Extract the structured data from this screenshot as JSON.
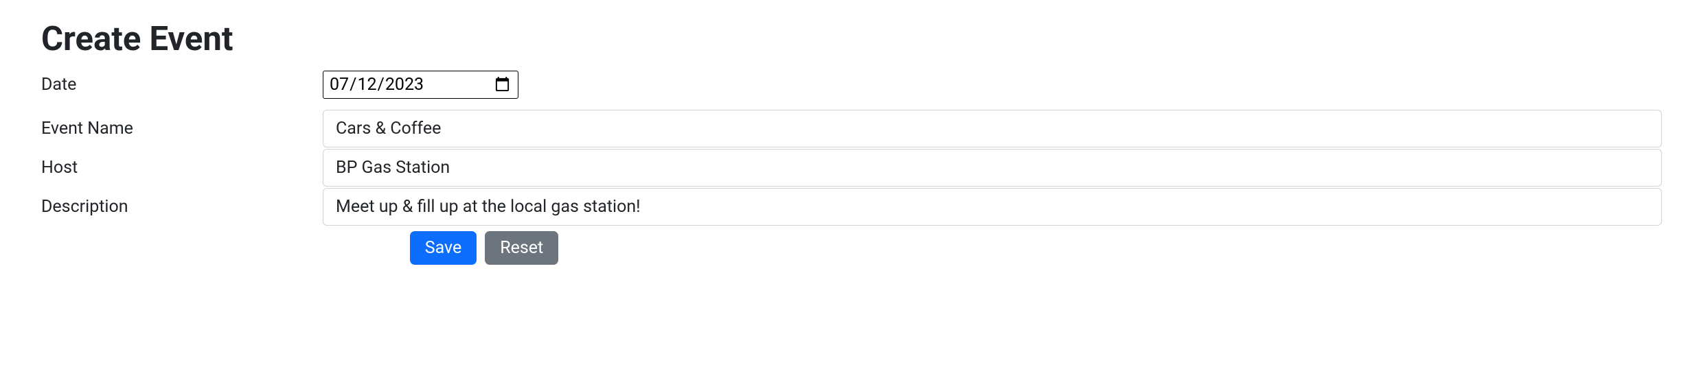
{
  "page": {
    "title": "Create Event"
  },
  "form": {
    "date_label": "Date",
    "date_value": "2023-07-12",
    "event_name_label": "Event Name",
    "event_name_value": "Cars & Coffee",
    "host_label": "Host",
    "host_value": "BP Gas Station",
    "description_label": "Description",
    "description_value": "Meet up & fill up at the local gas station!"
  },
  "buttons": {
    "save": "Save",
    "reset": "Reset"
  }
}
